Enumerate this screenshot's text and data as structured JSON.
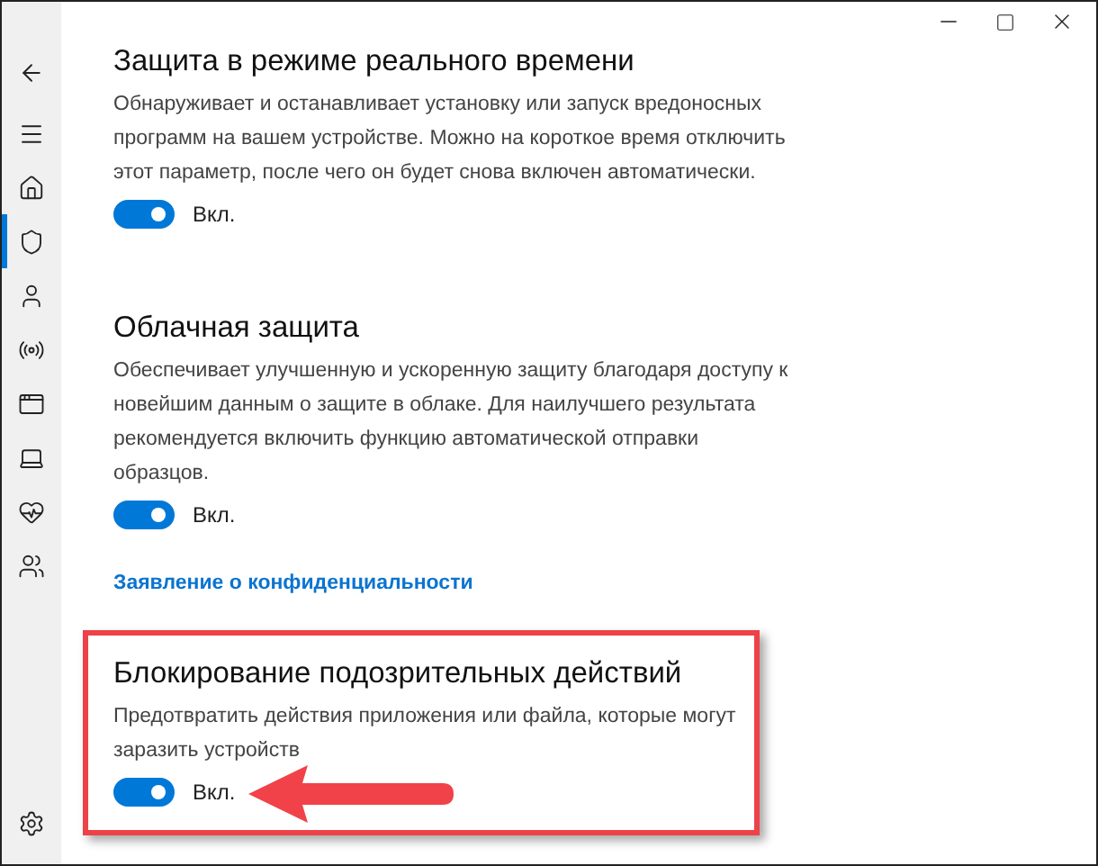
{
  "sidebar": {
    "items": [
      {
        "selected": false
      },
      {
        "selected": false
      },
      {
        "selected": false
      },
      {
        "selected": true
      },
      {
        "selected": false
      },
      {
        "selected": false
      },
      {
        "selected": false
      },
      {
        "selected": false
      },
      {
        "selected": false
      },
      {
        "selected": false
      }
    ]
  },
  "sections": [
    {
      "kind": "setting",
      "title": "Защита в режиме реального времени",
      "description": "Обнаруживает и останавливает установку или запуск вредоносных программ на вашем устройстве. Можно на короткое время отключить этот параметр, после чего он будет снова включен автоматически.",
      "toggle": {
        "on": true,
        "label": "Вкл."
      }
    },
    {
      "kind": "setting",
      "title": "Облачная защита",
      "description": "Обеспечивает улучшенную и ускоренную защиту благодаря доступу к новейшим данным о защите в облаке. Для наилучшего результата рекомендуется включить функцию автоматической отправки образцов.",
      "toggle": {
        "on": true,
        "label": "Вкл."
      }
    },
    {
      "kind": "link",
      "text": "Заявление о конфиденциальности"
    },
    {
      "kind": "framed_setting",
      "title": "Блокирование подозрительных действий",
      "description": "Предотвратить действия приложения или файла, которые могут заразить устройств",
      "toggle": {
        "on": true,
        "label": "Вкл."
      }
    }
  ]
}
